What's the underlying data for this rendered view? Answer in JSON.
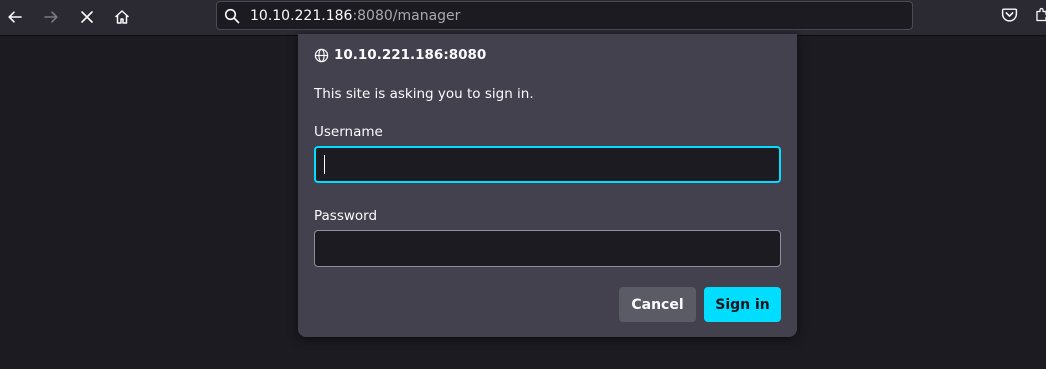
{
  "toolbar": {
    "back_icon": "back-arrow-icon",
    "forward_icon": "forward-arrow-icon",
    "stop_icon": "stop-loading-icon",
    "home_icon": "home-icon",
    "url_host": "10.10.221.186",
    "url_rest": ":8080/manager",
    "pocket_icon": "pocket-icon",
    "extensions_icon": "extensions-icon"
  },
  "dialog": {
    "origin": "10.10.221.186:8080",
    "message": "This site is asking you to sign in.",
    "username_label": "Username",
    "username_value": "",
    "password_label": "Password",
    "password_value": "",
    "cancel_label": "Cancel",
    "signin_label": "Sign in"
  },
  "colors": {
    "accent": "#00ddff",
    "dialog_bg": "#42414d",
    "toolbar_bg": "#2b2a33",
    "page_bg": "#1c1b22"
  }
}
